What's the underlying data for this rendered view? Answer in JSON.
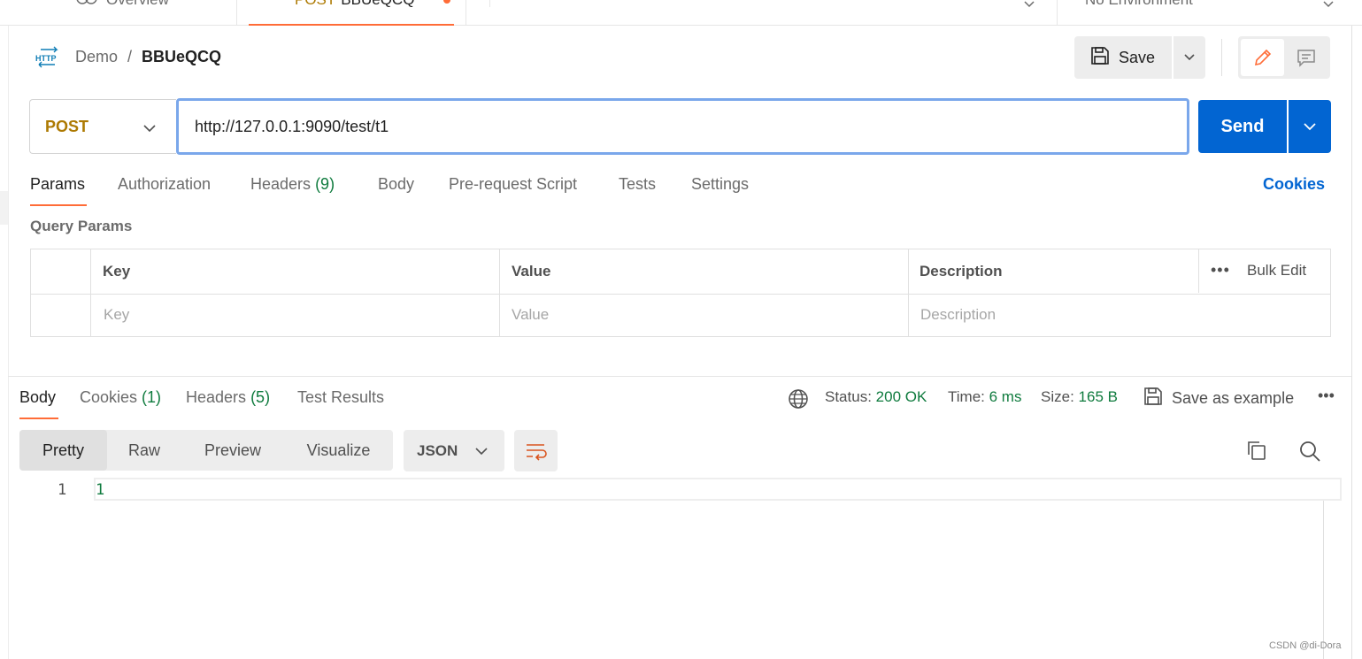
{
  "tabs": {
    "overview_label": "Overview",
    "active_tab_method": "POST",
    "active_tab_name": "BBUeQCQ",
    "environment_label": "No Environment"
  },
  "breadcrumb": {
    "icon_text": "HTTP",
    "parent": "Demo",
    "separator": "/",
    "current": "BBUeQCQ"
  },
  "toolbar": {
    "save_label": "Save"
  },
  "request": {
    "method": "POST",
    "url": "http://127.0.0.1:9090/test/t1",
    "send_label": "Send"
  },
  "request_tabs": [
    {
      "label": "Params"
    },
    {
      "label": "Authorization"
    },
    {
      "label": "Headers",
      "count": "(9)"
    },
    {
      "label": "Body"
    },
    {
      "label": "Pre-request Script"
    },
    {
      "label": "Tests"
    },
    {
      "label": "Settings"
    }
  ],
  "cookies_link": "Cookies",
  "query_params": {
    "title": "Query Params",
    "headers": [
      "Key",
      "Value",
      "Description"
    ],
    "more": "•••",
    "bulk_edit": "Bulk Edit",
    "placeholders": [
      "Key",
      "Value",
      "Description"
    ]
  },
  "response": {
    "tabs": [
      {
        "label": "Body"
      },
      {
        "label": "Cookies",
        "count": "(1)"
      },
      {
        "label": "Headers",
        "count": "(5)"
      },
      {
        "label": "Test Results"
      }
    ],
    "status_label": "Status:",
    "status_value": "200 OK",
    "time_label": "Time:",
    "time_value": "6 ms",
    "size_label": "Size:",
    "size_value": "165 B",
    "save_example": "Save as example",
    "more": "•••",
    "view_modes": [
      "Pretty",
      "Raw",
      "Preview",
      "Visualize"
    ],
    "format": "JSON",
    "line_number": "1",
    "body_line": "1"
  },
  "watermark": "CSDN @di-Dora",
  "colors": {
    "accent_orange": "#ff6c37",
    "send_blue": "#0265d2",
    "method_post": "#ad7a03",
    "success_green": "#0f7b3e"
  }
}
